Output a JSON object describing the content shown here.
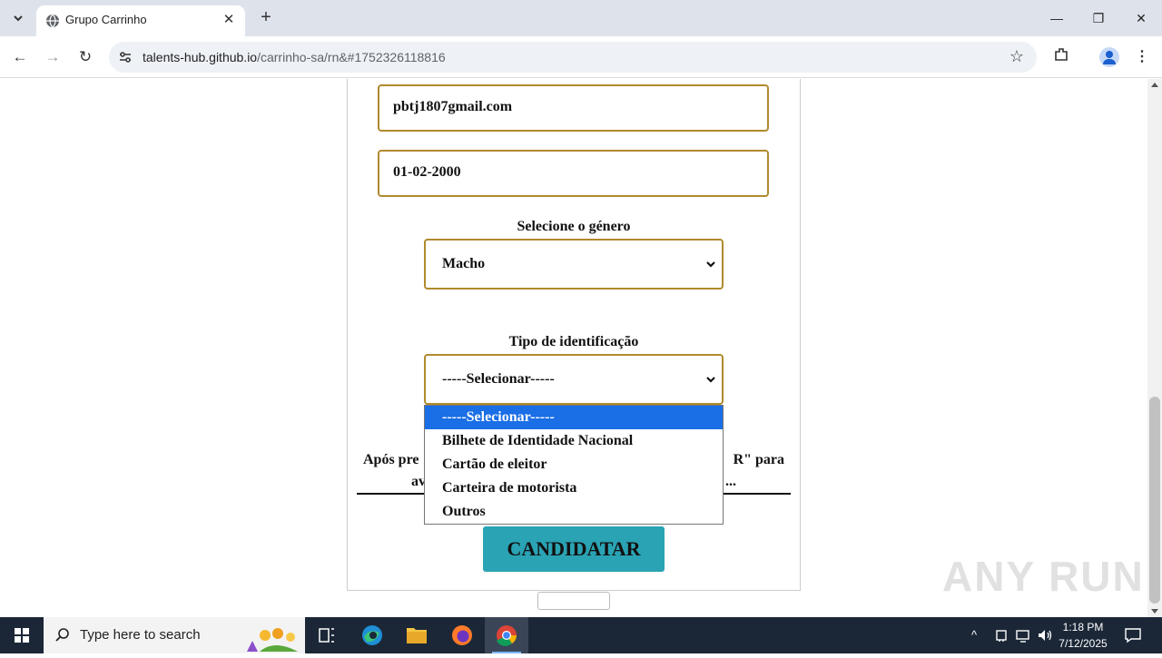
{
  "browser": {
    "tab_title": "Grupo Carrinho",
    "url_host": "talents-hub.github.io",
    "url_path": "/carrinho-sa/rn&#1752326118816"
  },
  "form": {
    "email_value": "pbtj1807gmail.com",
    "birthdate_value": "01-02-2000",
    "gender_label": "Selecione o género",
    "gender_selected": "Macho",
    "id_type_label": "Tipo de identificação",
    "id_type_selected": "-----Selecionar-----",
    "id_type_options": [
      "-----Selecionar-----",
      "Bilhete de Identidade Nacional",
      "Cartão de eleitor",
      "Carteira de motorista",
      "Outros"
    ],
    "info_line1_left": "Após pre",
    "info_line1_right": "R\" para",
    "info_line2_left": "av",
    "info_line2_right": "...",
    "submit_label": "CANDIDATAR"
  },
  "watermark": "ANY RUN",
  "taskbar": {
    "search_placeholder": "Type here to search",
    "time": "1:18 PM",
    "date": "7/12/2025"
  }
}
